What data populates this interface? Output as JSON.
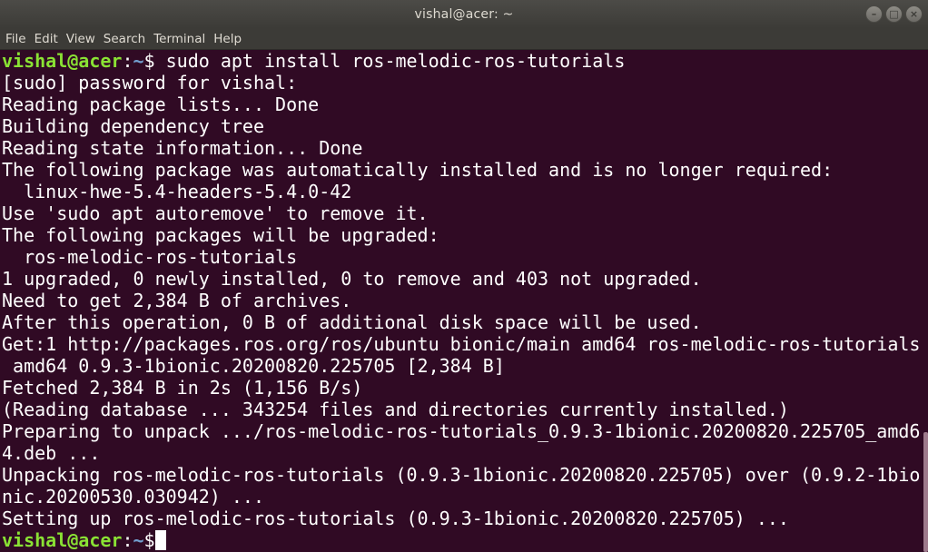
{
  "window": {
    "title": "vishal@acer: ~"
  },
  "menu": [
    "File",
    "Edit",
    "View",
    "Search",
    "Terminal",
    "Help"
  ],
  "prompt": {
    "user_host": "vishal@acer",
    "sep": ":",
    "path": "~",
    "symbol": "$"
  },
  "command": " sudo apt install ros-melodic-ros-tutorials",
  "output": [
    "[sudo] password for vishal:",
    "Reading package lists... Done",
    "Building dependency tree",
    "Reading state information... Done",
    "The following package was automatically installed and is no longer required:",
    "  linux-hwe-5.4-headers-5.4.0-42",
    "Use 'sudo apt autoremove' to remove it.",
    "The following packages will be upgraded:",
    "  ros-melodic-ros-tutorials",
    "1 upgraded, 0 newly installed, 0 to remove and 403 not upgraded.",
    "Need to get 2,384 B of archives.",
    "After this operation, 0 B of additional disk space will be used.",
    "Get:1 http://packages.ros.org/ros/ubuntu bionic/main amd64 ros-melodic-ros-tutorials",
    " amd64 0.9.3-1bionic.20200820.225705 [2,384 B]",
    "Fetched 2,384 B in 2s (1,156 B/s)",
    "(Reading database ... 343254 files and directories currently installed.)",
    "Preparing to unpack .../ros-melodic-ros-tutorials_0.9.3-1bionic.20200820.225705_amd6",
    "4.deb ...",
    "Unpacking ros-melodic-ros-tutorials (0.9.3-1bionic.20200820.225705) over (0.9.2-1bio",
    "nic.20200530.030942) ...",
    "Setting up ros-melodic-ros-tutorials (0.9.3-1bionic.20200820.225705) ..."
  ],
  "colors": {
    "background": "#300a24",
    "prompt_user": "#8ae234",
    "prompt_path": "#729fcf",
    "text": "#ffffff"
  },
  "icons": {
    "minimize": "minimize-icon",
    "maximize": "maximize-icon",
    "close": "close-icon"
  }
}
